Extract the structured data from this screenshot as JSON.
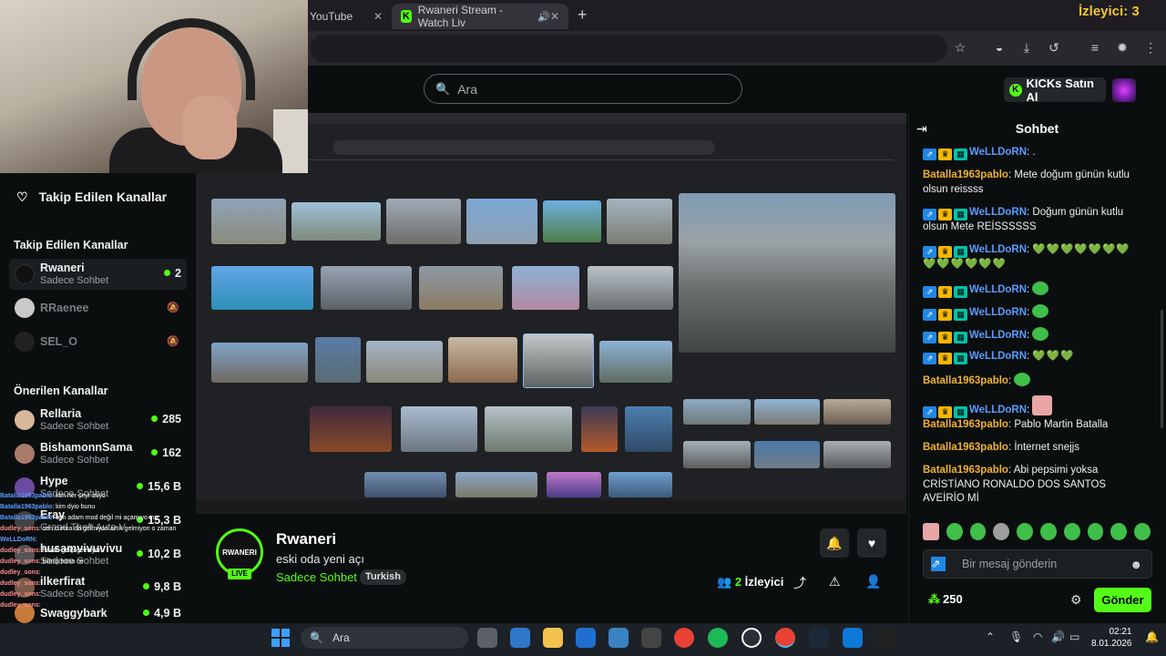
{
  "browser": {
    "tabs": [
      {
        "label": "YouTube"
      },
      {
        "label": "Rwaneri Stream - Watch Liv"
      }
    ],
    "overlay_viewers": "İzleyici: 3"
  },
  "kick_nav": {
    "search_placeholder": "Ara",
    "kicks_button": "KICKs Satın Al"
  },
  "sidebar": {
    "followed_header": "Takip Edilen Kanallar",
    "followed_section": "Takip Edilen Kanallar",
    "followed": [
      {
        "name": "Rwaneri",
        "sub": "Sadece Sohbet",
        "count": "2",
        "live": true
      },
      {
        "name": "RRaenee",
        "sub": "",
        "count": "",
        "live": false
      },
      {
        "name": "SEL_O",
        "sub": "",
        "count": "",
        "live": false
      }
    ],
    "recommended_section": "Önerilen Kanallar",
    "recommended": [
      {
        "name": "Rellaria",
        "sub": "Sadece Sohbet",
        "count": "285"
      },
      {
        "name": "BishamonnSama",
        "sub": "Sadece Sohbet",
        "count": "162"
      },
      {
        "name": "Hype",
        "sub": "Sadece Sohbet",
        "count": "15,6 B"
      },
      {
        "name": "Eray",
        "sub": "Grand Theft Auto V",
        "count": "15,3 B"
      },
      {
        "name": "husamvivuvivu",
        "sub": "Sadece Sohbet",
        "count": "10,2 B"
      },
      {
        "name": "ilkerfirat",
        "sub": "Sadece Sohbet",
        "count": "9,8 B"
      },
      {
        "name": "Swaggybark",
        "sub": "",
        "count": "4,9 B"
      }
    ]
  },
  "stream_overlay_chat": [
    {
      "user": "Batalla1963pablo",
      "text": ": kim her şeyi izliyo"
    },
    {
      "user": "Batalla1963pablo",
      "text": ": kim dyio bunu"
    },
    {
      "user": "Batalla1963pablo",
      "text": ": olm adam mod değil mi açamıyo mu"
    },
    {
      "user": "dudley_sons",
      "text": ": sen curma da gelmiyon artık gelmiyon o zaman"
    },
    {
      "user": "WeLLDoRN",
      "text": ":"
    },
    {
      "user": "dudley_sons",
      "text": ": havalı gelip gelmiyon"
    },
    {
      "user": "dudley_sons",
      "text": ": bilmiş bana ne"
    },
    {
      "user": "dudley_sons",
      "text": ":"
    },
    {
      "user": "dudley_sons",
      "text": ":"
    },
    {
      "user": "dudley_sons",
      "text": ":"
    },
    {
      "user": "dudley_sons",
      "text": ":"
    }
  ],
  "stream_info": {
    "channel": "Rwaneri",
    "avatar_text": "RWANERI",
    "live": "LIVE",
    "title": "eski oda yeni açı",
    "category": "Sadece Sohbet",
    "language": "Turkish",
    "viewers_number": "2",
    "viewers_label": "İzleyici"
  },
  "chat": {
    "header": "Sohbet",
    "messages": [
      {
        "user": "WeLLDoRN",
        "style": "blue",
        "badges": true,
        "text": ": ."
      },
      {
        "user": "Batalla1963pablo",
        "style": "orange",
        "badges": false,
        "text": ": Mete doğum günün kutlu olsun reissss"
      },
      {
        "user": "WeLLDoRN",
        "style": "blue",
        "badges": true,
        "text": ": Doğum günün kutlu olsun Mete REİSSSSSS"
      },
      {
        "user": "WeLLDoRN",
        "style": "blue",
        "badges": true,
        "text": ": ",
        "hearts": "💚💚💚💚💚💚💚💚💚💚💚💚💚"
      },
      {
        "user": "WeLLDoRN",
        "style": "blue",
        "badges": true,
        "text": ": ",
        "emote": "frog"
      },
      {
        "user": "WeLLDoRN",
        "style": "blue",
        "badges": true,
        "text": ": ",
        "emote": "frog"
      },
      {
        "user": "WeLLDoRN",
        "style": "blue",
        "badges": true,
        "text": ": ",
        "emote": "frog"
      },
      {
        "user": "WeLLDoRN",
        "style": "blue",
        "badges": true,
        "text": ": ",
        "hearts": "💚💚💚"
      },
      {
        "user": "Batalla1963pablo",
        "style": "orange",
        "badges": false,
        "text": ": ",
        "emote": "frog"
      },
      {
        "user": "WeLLDoRN",
        "style": "blue",
        "badges": true,
        "text": ": ",
        "emote": "pink"
      },
      {
        "user": "Batalla1963pablo",
        "style": "orange",
        "badges": false,
        "text": ": Pablo Martin Batalla"
      },
      {
        "user": "Batalla1963pablo",
        "style": "orange",
        "badges": false,
        "text": ": İnternet snejjs"
      },
      {
        "user": "Batalla1963pablo",
        "style": "orange",
        "badges": false,
        "text": ": Abi pepsimi yoksa CRİSTİANO RONALDO DOS SANTOS AVEİRİO Mİ"
      }
    ],
    "input_placeholder": "Bir mesaj gönderin",
    "points": "250",
    "send_label": "Gönder"
  },
  "taskbar": {
    "search_label": "Ara",
    "time": "02:21",
    "date": "8.01.2026"
  },
  "colors": {
    "kick_green": "#53fc18",
    "background": "#0b0e0f",
    "username_blue": "#5b9bff",
    "username_orange": "#f0b230"
  }
}
